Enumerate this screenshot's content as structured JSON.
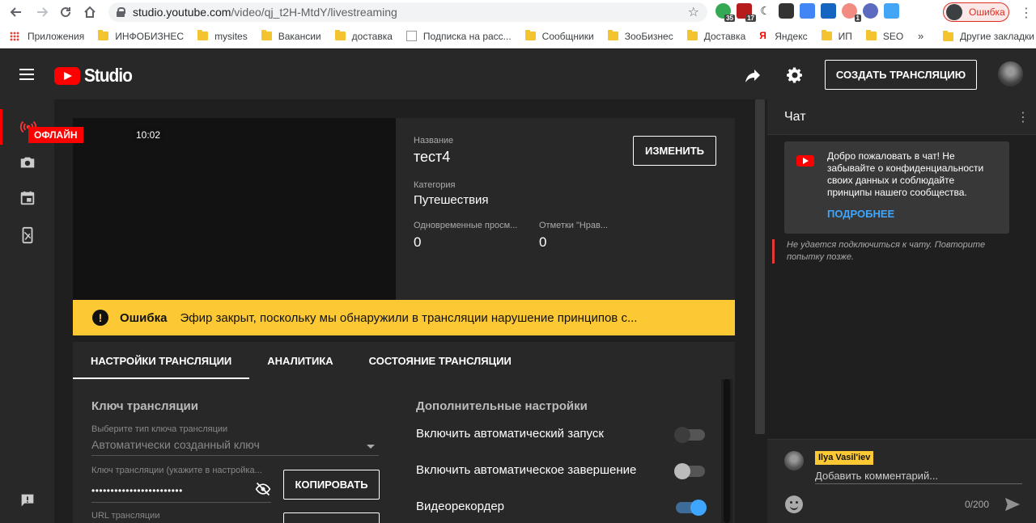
{
  "browser": {
    "url_host": "studio.youtube.com",
    "url_path": "/video/qj_t2H-MtdY/livestreaming",
    "ext_badges": [
      "35",
      "17",
      "1"
    ],
    "profile_label": "Ошибка",
    "bookmarks": [
      "Приложения",
      "ИНФОБИЗНЕС",
      "mysites",
      "Вакансии",
      "доставка",
      "Подписка на расс...",
      "Сообщники",
      "ЗооБизнес",
      "Доставка",
      "Яндекс",
      "ИП",
      "SEO"
    ],
    "bookmarks_more": "»",
    "other_bookmarks": "Другие закладки"
  },
  "header": {
    "logo_text": "Studio",
    "create_stream": "СОЗДАТЬ ТРАНСЛЯЦИЮ"
  },
  "stream": {
    "status_badge": "ОФЛАЙН",
    "time": "10:02",
    "title_label": "Название",
    "title": "тест4",
    "category_label": "Категория",
    "category": "Путешествия",
    "concurrent_label": "Одновременные просм...",
    "concurrent_value": "0",
    "likes_label": "Отметки \"Нрав...",
    "likes_value": "0",
    "edit_button": "ИЗМЕНИТЬ"
  },
  "error": {
    "title": "Ошибка",
    "message": "Эфир закрыт, поскольку мы обнаружили в трансляции нарушение принципов с..."
  },
  "tabs": [
    "НАСТРОЙКИ ТРАНСЛЯЦИИ",
    "АНАЛИТИКА",
    "СОСТОЯНИЕ ТРАНСЛЯЦИИ"
  ],
  "settings": {
    "key_section": "Ключ трансляции",
    "key_type_label": "Выберите тип ключа трансляции",
    "key_type_value": "Автоматически созданный ключ",
    "key_label": "Ключ трансляции (укажите в настройка...",
    "key_value": "••••••••••••••••••••••••",
    "copy_button": "КОПИРОВАТЬ",
    "url_label": "URL трансляции",
    "extra_section": "Дополнительные настройки",
    "toggles": [
      {
        "label": "Включить автоматический запуск",
        "state": "off"
      },
      {
        "label": "Включить автоматическое завершение",
        "state": "off"
      },
      {
        "label": "Видеорекордер",
        "state": "on"
      }
    ]
  },
  "chat": {
    "title": "Чат",
    "welcome": "Добро пожаловать в чат! Не забывайте о конфиденциальности своих данных и соблюдайте принципы нашего сообщества.",
    "more": "ПОДРОБНЕЕ",
    "error": "Не удается подключиться к чату. Повторите попытку позже.",
    "user": "Ilya Vasil'iev",
    "placeholder": "Добавить комментарий...",
    "counter": "0/200"
  },
  "colors": {
    "accent_red": "#ff0000",
    "warning_yellow": "#fcc934",
    "link_blue": "#3ea6ff"
  }
}
